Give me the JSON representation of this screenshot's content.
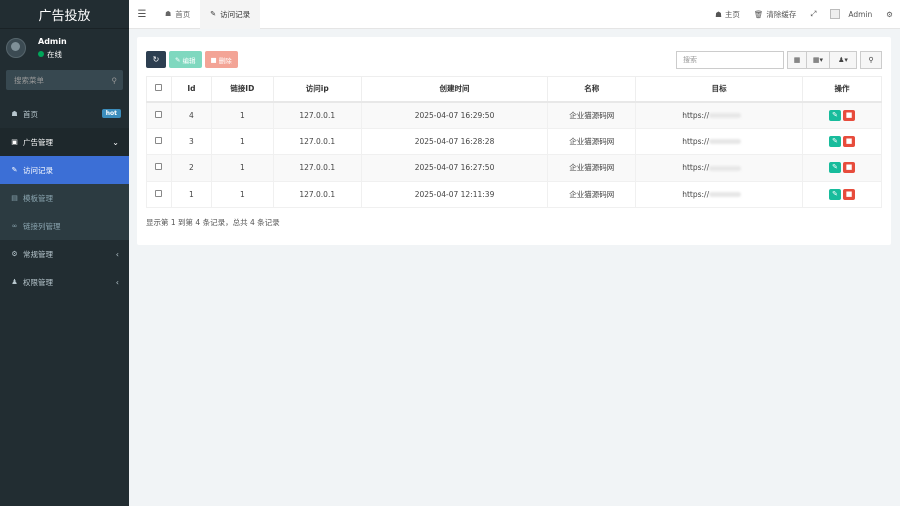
{
  "brand": "广告投放",
  "user": {
    "name": "Admin",
    "status": "在线"
  },
  "sidebar": {
    "search_placeholder": "搜索菜单",
    "items": [
      {
        "label": "首页",
        "icon": "home-icon",
        "badge": "hot"
      },
      {
        "label": "广告管理",
        "icon": "ad-icon"
      },
      {
        "label": "访问记录",
        "icon": "pencil-icon"
      },
      {
        "label": "模板管理",
        "icon": "template-icon"
      },
      {
        "label": "链接列管理",
        "icon": "link-icon"
      },
      {
        "label": "常规管理",
        "icon": "gears-icon"
      },
      {
        "label": "权限管理",
        "icon": "users-icon"
      }
    ]
  },
  "topbar": {
    "tabs": [
      {
        "label": "首页"
      },
      {
        "label": "访问记录"
      }
    ],
    "home_label": "主页",
    "clear_cache_label": "清除缓存",
    "admin_label": "Admin"
  },
  "toolbar": {
    "edit_label": "编辑",
    "delete_label": "删除",
    "search_placeholder": "搜索"
  },
  "table": {
    "columns": [
      "Id",
      "链接ID",
      "访问ip",
      "创建时间",
      "名称",
      "目标",
      "操作"
    ],
    "rows": [
      {
        "id": "4",
        "link_id": "1",
        "ip": "127.0.0.1",
        "created": "2025-04-07 16:29:50",
        "name": "企业猫源码网",
        "target": "https://"
      },
      {
        "id": "3",
        "link_id": "1",
        "ip": "127.0.0.1",
        "created": "2025-04-07 16:28:28",
        "name": "企业猫源码网",
        "target": "https://"
      },
      {
        "id": "2",
        "link_id": "1",
        "ip": "127.0.0.1",
        "created": "2025-04-07 16:27:50",
        "name": "企业猫源码网",
        "target": "https://"
      },
      {
        "id": "1",
        "link_id": "1",
        "ip": "127.0.0.1",
        "created": "2025-04-07 12:11:39",
        "name": "企业猫源码网",
        "target": "https://"
      }
    ]
  },
  "pager_text": "显示第 1 到第 4 条记录，总共 4 条记录"
}
